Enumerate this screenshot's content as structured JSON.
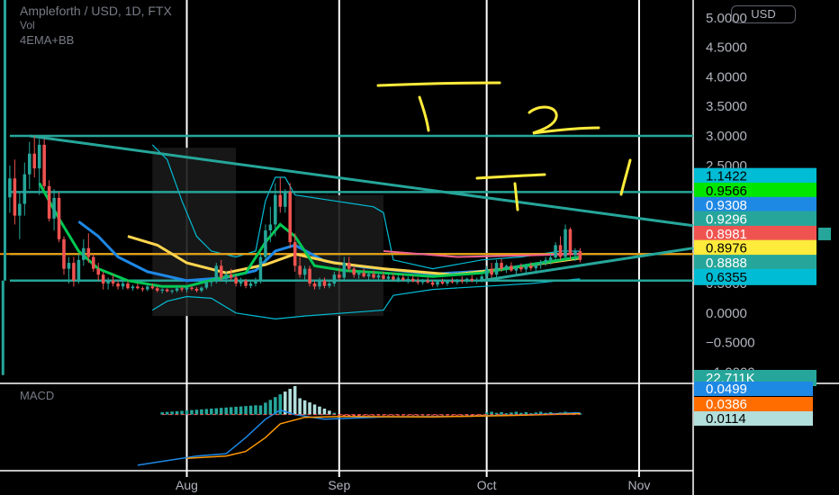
{
  "header": {
    "symbol_line": "Ampleforth / USD, 1D, FTX",
    "vol_label": "Vol",
    "indicator_label": "4EMA+BB",
    "currency_button": "USD",
    "macd_label": "MACD"
  },
  "colors": {
    "background": "#000000",
    "grid": "#ffffff",
    "axis_text": "#b2b5be",
    "up": "#26a69a",
    "down": "#ef5350",
    "trend": "#26a69a",
    "ema_green": "#00c853",
    "ema_blue": "#1e88e5",
    "ema_yellow": "#ffd54f",
    "bb": "#00bcd4",
    "pink": "#f06292",
    "orange": "#ff9800",
    "annotation": "#ffeb3b"
  },
  "chart_data": [
    {
      "type": "candlestick",
      "title": "Ampleforth / USD, 1D, FTX",
      "x_ticks": [
        "Aug",
        "Sep",
        "Oct",
        "Nov"
      ],
      "y_ticks": [
        "5.0000",
        "4.5000",
        "4.0000",
        "3.5000",
        "3.0000",
        "2.5000",
        "2.0000",
        "1.5000",
        "1.0000",
        "0.5000",
        "0.0000",
        "−0.5000",
        "−1.0000"
      ],
      "ylim": [
        -1.1,
        5.15
      ],
      "x_range_days": [
        -38,
        103
      ],
      "grid": true,
      "candles_ohlc_by_day": [
        [
          -36,
          1.96,
          2.5,
          1.7,
          2.28
        ],
        [
          -35,
          2.28,
          2.6,
          1.5,
          1.65
        ],
        [
          -34,
          1.65,
          2.05,
          1.25,
          1.85
        ],
        [
          -33,
          1.85,
          2.55,
          1.65,
          2.35
        ],
        [
          -32,
          2.35,
          2.9,
          2.1,
          2.7
        ],
        [
          -31,
          2.7,
          3.0,
          2.3,
          2.45
        ],
        [
          -30,
          2.45,
          2.95,
          2.0,
          2.85
        ],
        [
          -29,
          2.85,
          2.95,
          2.1,
          2.15
        ],
        [
          -28,
          2.15,
          2.25,
          1.55,
          1.6
        ],
        [
          -27,
          1.6,
          2.1,
          1.4,
          1.95
        ],
        [
          -26,
          1.95,
          2.05,
          1.2,
          1.25
        ],
        [
          -25,
          1.25,
          1.3,
          0.65,
          0.75
        ],
        [
          -24,
          0.75,
          0.95,
          0.5,
          0.85
        ],
        [
          -23,
          0.85,
          0.95,
          0.45,
          0.55
        ],
        [
          -22,
          0.55,
          1.0,
          0.5,
          0.9
        ],
        [
          -21,
          0.9,
          1.25,
          0.8,
          1.1
        ],
        [
          -20,
          1.1,
          1.35,
          0.85,
          0.95
        ],
        [
          -19,
          0.95,
          1.0,
          0.7,
          0.75
        ],
        [
          -18,
          0.75,
          0.85,
          0.55,
          0.65
        ],
        [
          -17,
          0.65,
          0.7,
          0.4,
          0.5
        ],
        [
          -16,
          0.5,
          0.6,
          0.4,
          0.55
        ],
        [
          -15,
          0.55,
          0.65,
          0.45,
          0.5
        ],
        [
          -14,
          0.5,
          0.55,
          0.4,
          0.45
        ],
        [
          -13,
          0.45,
          0.55,
          0.4,
          0.5
        ],
        [
          -12,
          0.5,
          0.55,
          0.4,
          0.42
        ],
        [
          -11,
          0.42,
          0.48,
          0.38,
          0.45
        ],
        [
          -10,
          0.45,
          0.5,
          0.4,
          0.42
        ],
        [
          -9,
          0.42,
          0.45,
          0.36,
          0.4
        ],
        [
          -8,
          0.4,
          0.48,
          0.37,
          0.45
        ],
        [
          -7,
          0.45,
          0.5,
          0.4,
          0.42
        ],
        [
          -6,
          0.42,
          0.45,
          0.35,
          0.38
        ],
        [
          -5,
          0.38,
          0.42,
          0.33,
          0.4
        ],
        [
          -4,
          0.4,
          0.42,
          0.35,
          0.37
        ],
        [
          -3,
          0.37,
          0.4,
          0.33,
          0.38
        ],
        [
          -2,
          0.38,
          0.45,
          0.35,
          0.42
        ],
        [
          -1,
          0.42,
          0.45,
          0.36,
          0.4
        ],
        [
          0,
          0.4,
          0.45,
          0.35,
          0.43
        ],
        [
          1,
          0.43,
          0.46,
          0.38,
          0.41
        ],
        [
          2,
          0.41,
          0.44,
          0.35,
          0.38
        ],
        [
          3,
          0.38,
          0.45,
          0.35,
          0.43
        ],
        [
          4,
          0.43,
          0.55,
          0.4,
          0.52
        ],
        [
          5,
          0.52,
          0.6,
          0.45,
          0.55
        ],
        [
          6,
          0.55,
          0.85,
          0.5,
          0.8
        ],
        [
          7,
          0.8,
          0.9,
          0.55,
          0.6
        ],
        [
          8,
          0.6,
          0.7,
          0.5,
          0.65
        ],
        [
          9,
          0.65,
          0.75,
          0.55,
          0.6
        ],
        [
          10,
          0.6,
          0.65,
          0.45,
          0.5
        ],
        [
          11,
          0.5,
          0.6,
          0.45,
          0.55
        ],
        [
          12,
          0.55,
          0.58,
          0.42,
          0.46
        ],
        [
          13,
          0.46,
          0.55,
          0.42,
          0.5
        ],
        [
          14,
          0.5,
          0.6,
          0.45,
          0.55
        ],
        [
          15,
          0.55,
          1.0,
          0.5,
          0.95
        ],
        [
          16,
          0.95,
          1.5,
          0.85,
          1.4
        ],
        [
          17,
          1.4,
          1.8,
          1.2,
          1.5
        ],
        [
          18,
          1.5,
          2.2,
          1.3,
          2.0
        ],
        [
          19,
          2.0,
          2.3,
          1.7,
          1.8
        ],
        [
          20,
          1.8,
          2.1,
          1.7,
          2.05
        ],
        [
          21,
          2.05,
          2.2,
          1.1,
          1.2
        ],
        [
          22,
          1.2,
          1.35,
          0.7,
          0.8
        ],
        [
          23,
          0.8,
          0.95,
          0.6,
          0.65
        ],
        [
          24,
          0.65,
          0.8,
          0.55,
          0.75
        ],
        [
          25,
          0.75,
          0.8,
          0.45,
          0.5
        ],
        [
          26,
          0.5,
          0.55,
          0.4,
          0.45
        ],
        [
          27,
          0.45,
          0.6,
          0.4,
          0.55
        ],
        [
          28,
          0.55,
          0.6,
          0.42,
          0.46
        ],
        [
          29,
          0.46,
          0.55,
          0.42,
          0.5
        ],
        [
          30,
          0.5,
          0.7,
          0.45,
          0.65
        ],
        [
          31,
          0.65,
          0.75,
          0.55,
          0.6
        ],
        [
          32,
          0.6,
          0.95,
          0.55,
          0.85
        ],
        [
          33,
          0.85,
          0.95,
          0.7,
          0.75
        ],
        [
          34,
          0.75,
          0.8,
          0.6,
          0.65
        ],
        [
          35,
          0.65,
          0.72,
          0.58,
          0.68
        ],
        [
          36,
          0.68,
          0.75,
          0.6,
          0.62
        ],
        [
          37,
          0.62,
          0.7,
          0.55,
          0.66
        ],
        [
          38,
          0.66,
          0.72,
          0.58,
          0.6
        ],
        [
          39,
          0.6,
          0.68,
          0.55,
          0.64
        ],
        [
          40,
          0.64,
          0.7,
          0.56,
          0.58
        ],
        [
          41,
          0.58,
          0.66,
          0.54,
          0.62
        ],
        [
          42,
          0.62,
          0.68,
          0.55,
          0.57
        ],
        [
          43,
          0.57,
          0.64,
          0.52,
          0.6
        ],
        [
          44,
          0.6,
          0.66,
          0.54,
          0.56
        ],
        [
          45,
          0.56,
          0.62,
          0.5,
          0.58
        ],
        [
          46,
          0.58,
          0.64,
          0.52,
          0.54
        ],
        [
          47,
          0.54,
          0.6,
          0.48,
          0.52
        ],
        [
          48,
          0.52,
          0.58,
          0.48,
          0.55
        ],
        [
          49,
          0.55,
          0.6,
          0.5,
          0.52
        ],
        [
          50,
          0.52,
          0.56,
          0.45,
          0.48
        ],
        [
          51,
          0.48,
          0.55,
          0.44,
          0.53
        ],
        [
          52,
          0.53,
          0.58,
          0.48,
          0.5
        ],
        [
          53,
          0.5,
          0.56,
          0.46,
          0.54
        ],
        [
          54,
          0.54,
          0.6,
          0.5,
          0.52
        ],
        [
          55,
          0.52,
          0.58,
          0.48,
          0.56
        ],
        [
          56,
          0.56,
          0.62,
          0.5,
          0.54
        ],
        [
          57,
          0.54,
          0.6,
          0.5,
          0.58
        ],
        [
          58,
          0.58,
          0.64,
          0.52,
          0.55
        ],
        [
          59,
          0.55,
          0.6,
          0.5,
          0.57
        ],
        [
          60,
          0.57,
          0.65,
          0.52,
          0.62
        ],
        [
          61,
          0.62,
          0.8,
          0.58,
          0.75
        ],
        [
          62,
          0.75,
          0.85,
          0.6,
          0.65
        ],
        [
          63,
          0.65,
          0.9,
          0.6,
          0.85
        ],
        [
          64,
          0.85,
          0.92,
          0.7,
          0.75
        ],
        [
          65,
          0.75,
          0.82,
          0.68,
          0.8
        ],
        [
          66,
          0.8,
          0.86,
          0.7,
          0.72
        ],
        [
          67,
          0.72,
          0.8,
          0.66,
          0.78
        ],
        [
          68,
          0.78,
          0.84,
          0.7,
          0.74
        ],
        [
          69,
          0.74,
          0.82,
          0.68,
          0.8
        ],
        [
          70,
          0.8,
          0.86,
          0.72,
          0.76
        ],
        [
          71,
          0.76,
          0.84,
          0.7,
          0.82
        ],
        [
          72,
          0.82,
          0.9,
          0.75,
          0.86
        ],
        [
          73,
          0.86,
          0.95,
          0.8,
          0.9
        ],
        [
          74,
          0.9,
          1.0,
          0.82,
          0.94
        ],
        [
          75,
          0.94,
          1.2,
          0.88,
          1.15
        ],
        [
          76,
          1.15,
          1.3,
          0.9,
          0.95
        ],
        [
          77,
          0.95,
          1.5,
          0.92,
          1.42
        ],
        [
          78,
          1.42,
          1.45,
          0.9,
          0.98
        ],
        [
          79,
          0.98,
          1.1,
          0.88,
          1.05
        ],
        [
          80,
          1.05,
          1.1,
          0.86,
          0.9
        ]
      ],
      "price_labels": [
        {
          "text": "1.1422",
          "value": 2.32,
          "color": "#00bcd4",
          "text_color": "#000000"
        },
        {
          "text": "0.9566",
          "value": 2.07,
          "color": "#00e600",
          "text_color": "#000000"
        },
        {
          "text": "0.9308",
          "value": 1.83,
          "color": "#1e88e5",
          "text_color": "#ffffff"
        },
        {
          "text": "0.9296",
          "value": 1.59,
          "color": "#26a69a",
          "text_color": "#ffffff"
        },
        {
          "text": "0.8981",
          "value": 1.34,
          "color": "#ef5350",
          "text_color": "#ffffff"
        },
        {
          "text": "0.8976",
          "value": 1.1,
          "color": "#ffeb3b",
          "text_color": "#000000"
        },
        {
          "text": "0.8888",
          "value": 0.85,
          "color": "#26a69a",
          "text_color": "#ffffff"
        },
        {
          "text": "0.6355",
          "value": 0.61,
          "color": "#00bcd4",
          "text_color": "#000000"
        },
        {
          "text": "22.711K",
          "value": -1.1,
          "color": "#26a69a",
          "text_color": "#ffffff"
        }
      ],
      "horizontal_levels": [
        3.0,
        2.05,
        1.0,
        0.55
      ]
    },
    {
      "type": "bar",
      "title": "MACD",
      "ylim": [
        -0.12,
        0.06
      ],
      "labels": [
        {
          "text": "0.0499",
          "color": "#1e88e5",
          "text_color": "#ffffff"
        },
        {
          "text": "0.0386",
          "color": "#ff6d00",
          "text_color": "#ffffff"
        },
        {
          "text": "0.0114",
          "color": "#b2dfdb",
          "text_color": "#000000"
        }
      ]
    }
  ]
}
